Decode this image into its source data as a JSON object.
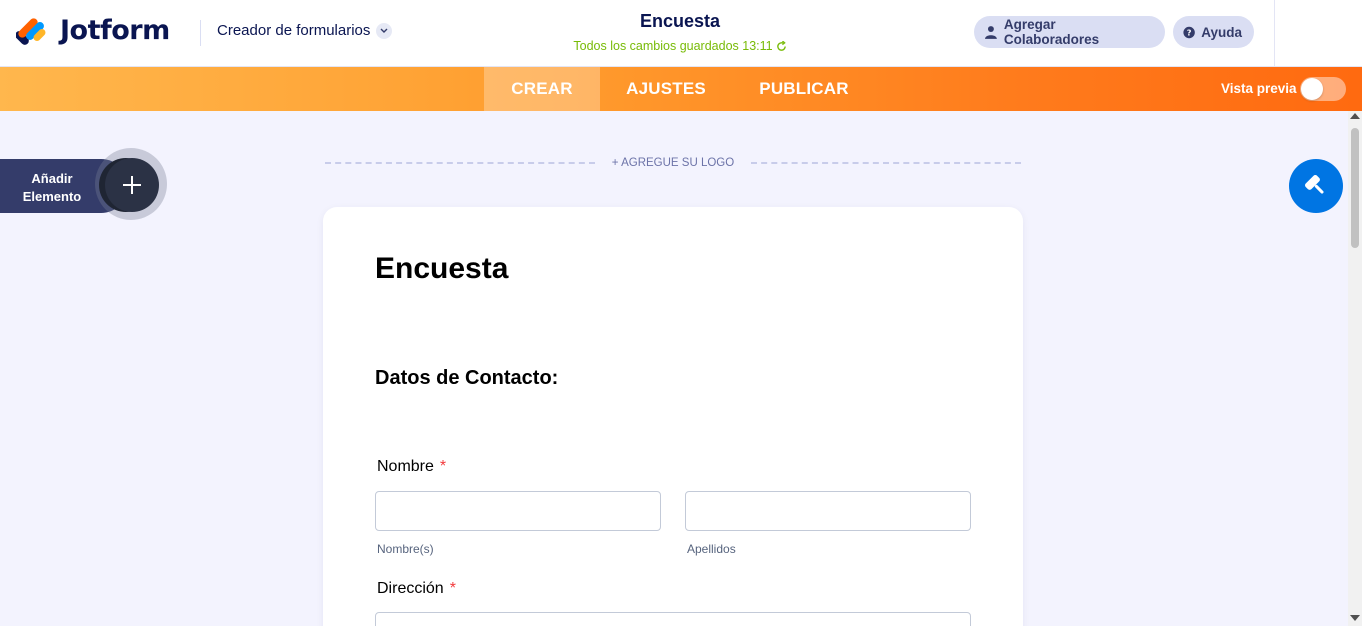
{
  "header": {
    "logo_text": "Jotform",
    "builder_menu": "Creador de formularios",
    "form_title": "Encuesta",
    "save_status": "Todos los cambios guardados 13:11",
    "collaborators_label": "Agregar Colaboradores",
    "help_label": "Ayuda"
  },
  "nav": {
    "tabs": [
      "CREAR",
      "AJUSTES",
      "PUBLICAR"
    ],
    "active_tab": "CREAR",
    "preview_label": "Vista previa",
    "preview_enabled": false
  },
  "sidebar": {
    "add_element_label": "Añadir Elemento"
  },
  "canvas": {
    "add_logo_label": "+ AGREGUE SU LOGO"
  },
  "form": {
    "title": "Encuesta",
    "section_heading": "Datos de Contacto:",
    "fields": [
      {
        "label": "Nombre",
        "required": true,
        "sublabels": [
          "Nombre(s)",
          "Apellidos"
        ]
      },
      {
        "label": "Dirección",
        "required": true
      }
    ]
  },
  "colors": {
    "brand_dark": "#0a1551",
    "saved_green": "#78bb07",
    "accent_orange": "#ff7b1c",
    "designer_blue": "#0075e3",
    "required_red": "#f23a3c"
  }
}
